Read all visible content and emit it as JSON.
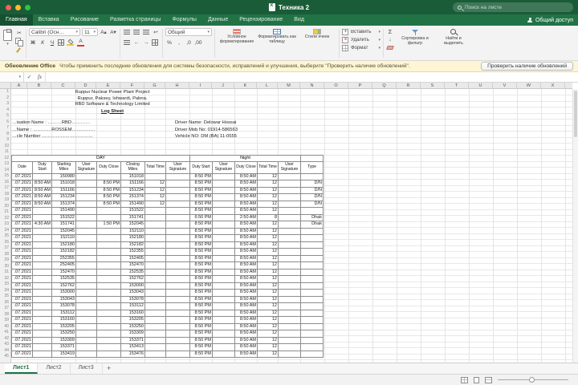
{
  "titlebar": {
    "title": "Техника 2",
    "search_placeholder": "Поиск на листе"
  },
  "ribbon_tabs": {
    "share_label": "Общий доступ",
    "items": [
      {
        "label": "Главная",
        "active": true
      },
      {
        "label": "Вставка"
      },
      {
        "label": "Рисование"
      },
      {
        "label": "Разметка страницы"
      },
      {
        "label": "Формулы"
      },
      {
        "label": "Данные"
      },
      {
        "label": "Рецензирование"
      },
      {
        "label": "Вид"
      }
    ]
  },
  "ribbon": {
    "font_name": "Calibri (Осн…",
    "font_size": "11",
    "style_buttons": [
      "Ж",
      "К",
      "Ч"
    ],
    "number_format": "Общий",
    "styles": [
      {
        "label": "Условное форматирование"
      },
      {
        "label": "Форматировать как таблицу"
      },
      {
        "label": "Стили ячеек"
      }
    ],
    "cells": [
      {
        "label": "Вставить"
      },
      {
        "label": "Удалить"
      },
      {
        "label": "Формат"
      }
    ],
    "editing": [
      {
        "label": "Сортировка и фильтр"
      },
      {
        "label": "Найти и выделить"
      }
    ]
  },
  "icons": {
    "dropdown": "▾",
    "check": "✓",
    "fx": "fx",
    "scissors": "✂",
    "percent": "%",
    "comma": ",",
    "dec_inc": ",0",
    "dec_dec": ",00",
    "wrap": "↩",
    "indent_l": "←",
    "indent_r": "→",
    "sigma": "Σ",
    "fill_down": "↓",
    "font_color_letter": "А",
    "a_up": "A▴",
    "a_down": "A▾"
  },
  "message_bar": {
    "title": "Обновление Office",
    "text": "Чтобы применить последние обновления для системы безопасности, исправлений и улучшения, выберите \"Проверить наличие обновлений\".",
    "button": "Проверить наличие обновлений"
  },
  "formula_bar": {
    "name_box": ""
  },
  "sheet": {
    "row_count": 45,
    "column_letters": [
      "A",
      "B",
      "C",
      "D",
      "E",
      "F",
      "G",
      "H",
      "I",
      "J",
      "K",
      "L",
      "M",
      "N",
      "O",
      "P",
      "Q",
      "R",
      "S",
      "T",
      "U",
      "V",
      "W",
      "X",
      "Y"
    ],
    "doc": {
      "heading": [
        "Ruppur Nuclear Power Plant Project",
        "Ruppur, Paksey, Ishwardi, Pabna.",
        "RBD Software & Technology Limited"
      ],
      "log_sheet": "Log Sheet",
      "info_left": [
        "…isation Name : ………RBD…………",
        "…Name : …………ROSSEM……………",
        "…cle Number ……………………………"
      ],
      "info_right": [
        "Driver Name: Delowar Hossai",
        "Driver Mob No: 01914-586563",
        "Vehicle NO: DM (BA) 11-0555"
      ]
    },
    "table": {
      "groups": [
        {
          "label": "DAY",
          "span": 8
        },
        {
          "label": "Night",
          "span": 5
        },
        {
          "label": "",
          "span": 1
        }
      ],
      "columns": [
        "Date",
        "Duty Start",
        "Starting Miles",
        "User Signature",
        "Duty Close",
        "Closing Miles",
        "Total Time",
        "User Signature",
        "Duty Start",
        "User Signature",
        "Duty Close",
        "Total Time",
        "User Signature",
        "Type"
      ],
      "rows": [
        [
          ".07.2021",
          "",
          "150980",
          "",
          "",
          "151018",
          "",
          "",
          "8:50 PM",
          "",
          "8:50 AM",
          "12",
          "",
          ""
        ],
        [
          ".07.2021",
          "8:50 AM",
          "151018",
          "",
          "8:50 PM",
          "151166",
          "12",
          "",
          "8:50 PM",
          "",
          "8:50 AM",
          "12",
          "",
          "D/N"
        ],
        [
          ".07.2021",
          "8:50 AM",
          "151166",
          "",
          "8:50 PM",
          "151234",
          "12",
          "",
          "8:50 PM",
          "",
          "8:50 AM",
          "12",
          "",
          "D/N"
        ],
        [
          ".07.2021",
          "8:50 AM",
          "151234",
          "",
          "8:50 PM",
          "151374",
          "12",
          "",
          "8:50 PM",
          "",
          "8:50 AM",
          "12",
          "",
          "D/N"
        ],
        [
          ".07.2021",
          "8:50 AM",
          "151374",
          "",
          "8:50 PM",
          "151490",
          "12",
          "",
          "8:50 PM",
          "",
          "8:50 AM",
          "12",
          "",
          "D/N"
        ],
        [
          ".07.2021",
          "",
          "151490",
          "",
          "",
          "151522",
          "",
          "",
          "8:50 PM",
          "",
          "8:50 AM",
          "12",
          "",
          ""
        ],
        [
          ".07.2021",
          "",
          "151522",
          "",
          "",
          "151741",
          "",
          "",
          "6:50 PM",
          "",
          "2:50 AM",
          "8",
          "",
          "Dhak"
        ],
        [
          ".07.2021",
          "4:30 AM",
          "151741",
          "",
          "1:50 PM",
          "152045",
          "",
          "",
          "8:50 PM",
          "",
          "8:50 AM",
          "12",
          "",
          "Dhak"
        ],
        [
          ".07.2021",
          "",
          "152045",
          "",
          "",
          "152110",
          "",
          "",
          "8:50 PM",
          "",
          "8:50 AM",
          "12",
          "",
          ""
        ],
        [
          ".07.2021",
          "",
          "152110",
          "",
          "",
          "152180",
          "",
          "",
          "8:50 PM",
          "",
          "8:50 AM",
          "12",
          "",
          ""
        ],
        [
          ".07.2021",
          "",
          "152180",
          "",
          "",
          "152182",
          "",
          "",
          "8:50 PM",
          "",
          "8:50 AM",
          "12",
          "",
          ""
        ],
        [
          ".07.2021",
          "",
          "152182",
          "",
          "",
          "152355",
          "",
          "",
          "8:50 PM",
          "",
          "8:50 AM",
          "12",
          "",
          ""
        ],
        [
          ".07.2021",
          "",
          "252355",
          "",
          "",
          "152405",
          "",
          "",
          "8:50 PM",
          "",
          "8:50 AM",
          "12",
          "",
          ""
        ],
        [
          ".07.2021",
          "",
          "252405",
          "",
          "",
          "152470",
          "",
          "",
          "8:50 PM",
          "",
          "8:50 AM",
          "12",
          "",
          ""
        ],
        [
          ".07.2021",
          "",
          "152470",
          "",
          "",
          "152535",
          "",
          "",
          "8:50 PM",
          "",
          "8:50 AM",
          "12",
          "",
          ""
        ],
        [
          ".07.2021",
          "",
          "152535",
          "",
          "",
          "152762",
          "",
          "",
          "8:50 PM",
          "",
          "8:50 AM",
          "12",
          "",
          ""
        ],
        [
          ".07.2021",
          "",
          "152762",
          "",
          "",
          "153000",
          "",
          "",
          "8:50 PM",
          "",
          "8:50 AM",
          "12",
          "",
          ""
        ],
        [
          ".07.2021",
          "",
          "153000",
          "",
          "",
          "153043",
          "",
          "",
          "8:50 PM",
          "",
          "8:50 AM",
          "12",
          "",
          ""
        ],
        [
          ".07.2021",
          "",
          "153043",
          "",
          "",
          "153078",
          "",
          "",
          "8:50 PM",
          "",
          "8:50 AM",
          "12",
          "",
          ""
        ],
        [
          ".07.2021",
          "",
          "153078",
          "",
          "",
          "153112",
          "",
          "",
          "8:50 PM",
          "",
          "8:50 AM",
          "12",
          "",
          ""
        ],
        [
          ".07.2021",
          "",
          "153112",
          "",
          "",
          "153160",
          "",
          "",
          "8:50 PM",
          "",
          "8:50 AM",
          "12",
          "",
          ""
        ],
        [
          ".07.2021",
          "",
          "153160",
          "",
          "",
          "153205",
          "",
          "",
          "8:50 PM",
          "",
          "8:50 AM",
          "12",
          "",
          ""
        ],
        [
          ".07.2021",
          "",
          "153205",
          "",
          "",
          "153250",
          "",
          "",
          "8:50 PM",
          "",
          "8:50 AM",
          "12",
          "",
          ""
        ],
        [
          ".07.2021",
          "",
          "153250",
          "",
          "",
          "153309",
          "",
          "",
          "8:50 PM",
          "",
          "8:50 AM",
          "12",
          "",
          ""
        ],
        [
          ".07.2021",
          "",
          "153309",
          "",
          "",
          "153371",
          "",
          "",
          "8:50 PM",
          "",
          "8:50 AM",
          "12",
          "",
          ""
        ],
        [
          ".07.2021",
          "",
          "153371",
          "",
          "",
          "153413",
          "",
          "",
          "8:50 PM",
          "",
          "8:50 AM",
          "12",
          "",
          ""
        ],
        [
          ".07.2021",
          "",
          "153419",
          "",
          "",
          "153476",
          "",
          "",
          "8:50 PM",
          "",
          "8:50 AM",
          "12",
          "",
          ""
        ]
      ],
      "red_cells": [
        [
          11,
          5
        ],
        [
          12,
          2
        ],
        [
          12,
          5
        ],
        [
          13,
          2
        ],
        [
          13,
          5
        ],
        [
          14,
          2
        ]
      ]
    }
  },
  "sheet_tabs": {
    "tabs": [
      {
        "label": "Лист1",
        "active": true
      },
      {
        "label": "Лист2"
      },
      {
        "label": "Лист3"
      }
    ],
    "add_label": "+"
  }
}
